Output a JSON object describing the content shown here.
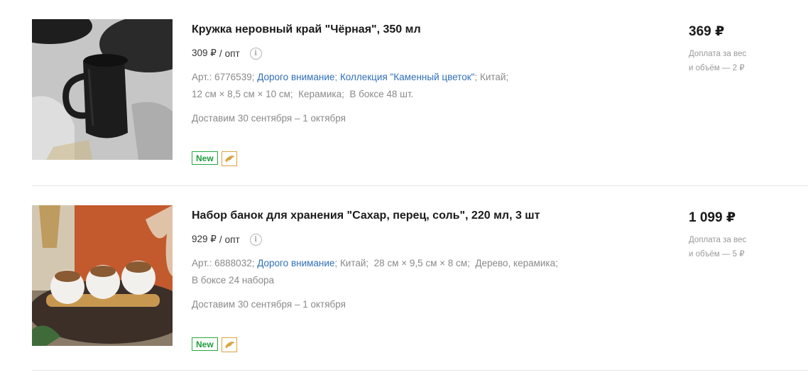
{
  "products": [
    {
      "title": "Кружка неровный край \"Чёрная\", 350 мл",
      "opt_price": "309 ₽",
      "opt_sep": "/",
      "opt_label": "опт",
      "info_symbol": "i",
      "art": "Арт.: 6776539;",
      "link1": "Дорого внимание",
      "sep1": ";",
      "link2": "Коллекция \"Каменный цветок\"",
      "sep2": ";",
      "tail1": "Китай;",
      "line2": "12 см × 8,5 см × 10 см;  Керамика;  В боксе 48 шт.",
      "delivery": "Доставим 30 сентября – 1 октября",
      "badge": "New",
      "price": "369 ₽",
      "surcharge_line1": "Доплата за вес",
      "surcharge_line2": "и объём — 2 ₽"
    },
    {
      "title": "Набор банок для хранения \"Сахар, перец, соль\", 220 мл, 3 шт",
      "opt_price": "929 ₽",
      "opt_sep": "/",
      "opt_label": "опт",
      "info_symbol": "i",
      "art": "Арт.: 6888032;",
      "link1": "Дорого внимание",
      "sep1": ";",
      "tail1": "Китай;  28 см × 9,5 см × 8 см;  Дерево, керамика;",
      "line2": "В боксе 24 набора",
      "delivery": "Доставим 30 сентября – 1 октября",
      "badge": "New",
      "price": "1 099 ₽",
      "surcharge_line1": "Доплата за вес",
      "surcharge_line2": "и объём — 5 ₽"
    }
  ]
}
